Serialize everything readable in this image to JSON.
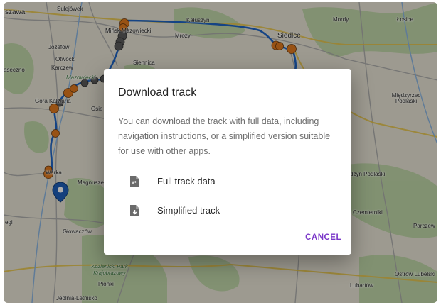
{
  "map": {
    "labels": {
      "warszawa": "szawa",
      "sulejowek": "Sulejówek",
      "kaluszyn": "Kałuszyn",
      "mordy": "Mordy",
      "losice": "Łosice",
      "minsk": "Mińsk Mazowiecki",
      "mrozy": "Mrozy",
      "siedlce": "Siedlce",
      "jozefow": "Józefów",
      "otwock": "Otwock",
      "karczew": "Karczew",
      "seczno": "aseczno",
      "siennica": "Siennica",
      "mazowiecki": "Mazowiecki",
      "gora_kalwaria": "Góra Kalwaria",
      "osiek": "Osie",
      "miedzyrzec": "Międzyrzec Podlaski",
      "warka": "Warka",
      "magnuszew": "Magnusze",
      "radzyn": "dzyń Podlaski",
      "czemierniki": "Czemierniki",
      "egi": "egi",
      "glowaczow": "Głowaczów",
      "parczew": "Parczew",
      "kozienicki": "Kozienicki Park Krajobrazowy",
      "pionki": "Pionki",
      "ostrow": "Ostrów Lubelski",
      "lubartow": "Lubartów",
      "jedlnia": "Jedlnia-Letnisko"
    },
    "colors": {
      "route": "#2065c4",
      "marker_orange": "#e07a1e",
      "marker_gray": "#555555",
      "pin": "#1e5fb8"
    }
  },
  "dialog": {
    "title": "Download track",
    "description": "You can download the track with full data, including navigation instructions, or a simplified version suitable for use with other apps.",
    "options": [
      {
        "label": "Full track data",
        "icon": "file-route-icon"
      },
      {
        "label": "Simplified track",
        "icon": "file-download-icon"
      }
    ],
    "cancel_label": "CANCEL"
  }
}
